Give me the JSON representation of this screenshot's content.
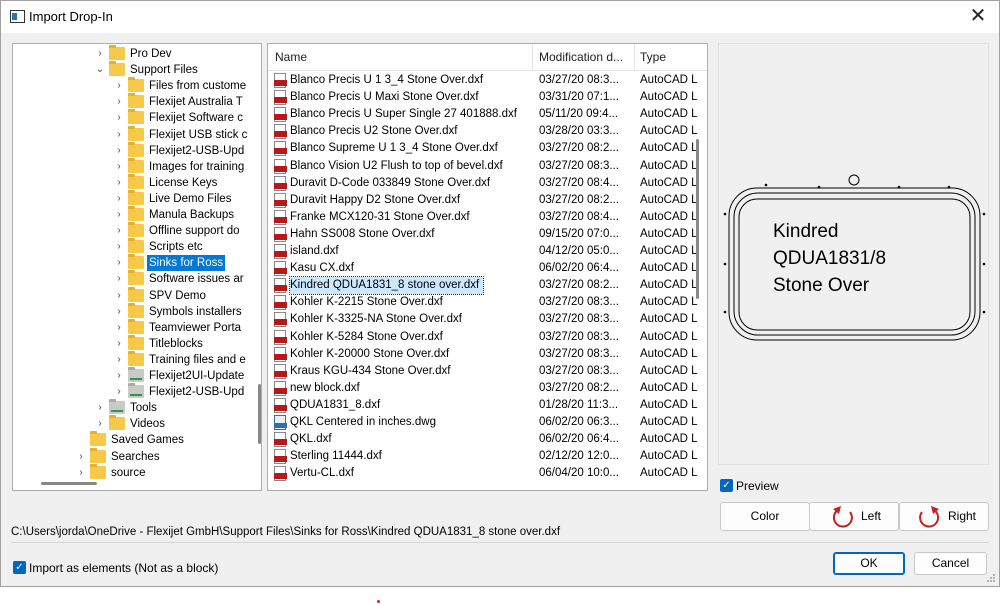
{
  "window": {
    "title": "Import Drop-In"
  },
  "tree": {
    "items": [
      {
        "label": "Pro Dev",
        "arrow": "›",
        "level": 4,
        "type": "folder"
      },
      {
        "label": "Support Files",
        "arrow": "⌄",
        "level": 4,
        "type": "folder"
      },
      {
        "label": "Files from custome",
        "arrow": "›",
        "level": 5,
        "type": "folder"
      },
      {
        "label": "Flexijet Australia T",
        "arrow": "›",
        "level": 5,
        "type": "folder"
      },
      {
        "label": "Flexijet Software c",
        "arrow": "›",
        "level": 5,
        "type": "folder"
      },
      {
        "label": "Flexijet USB stick c",
        "arrow": "›",
        "level": 5,
        "type": "folder"
      },
      {
        "label": "Flexijet2-USB-Upd",
        "arrow": "›",
        "level": 5,
        "type": "folder"
      },
      {
        "label": "Images for training",
        "arrow": "›",
        "level": 5,
        "type": "folder"
      },
      {
        "label": "License Keys",
        "arrow": "›",
        "level": 5,
        "type": "folder"
      },
      {
        "label": "Live Demo Files",
        "arrow": "›",
        "level": 5,
        "type": "folder"
      },
      {
        "label": "Manula Backups",
        "arrow": "›",
        "level": 5,
        "type": "folder"
      },
      {
        "label": "Offline support do",
        "arrow": "›",
        "level": 5,
        "type": "folder"
      },
      {
        "label": "Scripts etc",
        "arrow": "›",
        "level": 5,
        "type": "folder"
      },
      {
        "label": "Sinks for Ross",
        "arrow": "›",
        "level": 5,
        "type": "folder",
        "selected": true
      },
      {
        "label": "Software issues ar",
        "arrow": "›",
        "level": 5,
        "type": "folder"
      },
      {
        "label": "SPV Demo",
        "arrow": "›",
        "level": 5,
        "type": "folder"
      },
      {
        "label": "Symbols installers",
        "arrow": "›",
        "level": 5,
        "type": "folder"
      },
      {
        "label": "Teamviewer Porta",
        "arrow": "›",
        "level": 5,
        "type": "folder"
      },
      {
        "label": "Titleblocks",
        "arrow": "›",
        "level": 5,
        "type": "folder"
      },
      {
        "label": "Training files and e",
        "arrow": "›",
        "level": 5,
        "type": "folder"
      },
      {
        "label": "Flexijet2UI-Update",
        "arrow": "›",
        "level": 5,
        "type": "net"
      },
      {
        "label": "Flexijet2-USB-Upd",
        "arrow": "›",
        "level": 5,
        "type": "net"
      },
      {
        "label": "Tools",
        "arrow": "›",
        "level": 4,
        "type": "net"
      },
      {
        "label": "Videos",
        "arrow": "›",
        "level": 4,
        "type": "folder"
      },
      {
        "label": "Saved Games",
        "arrow": "",
        "level": 3,
        "type": "folder"
      },
      {
        "label": "Searches",
        "arrow": "›",
        "level": 3,
        "type": "folder"
      },
      {
        "label": "source",
        "arrow": "›",
        "level": 3,
        "type": "folder"
      }
    ]
  },
  "files": {
    "columns": {
      "name": "Name",
      "date": "Modification d...",
      "type": "Type"
    },
    "rows": [
      {
        "name": "Blanco Precis U 1 3_4 Stone Over.dxf",
        "date": "03/27/20 08:3...",
        "type": "AutoCAD L",
        "icon": "dxf"
      },
      {
        "name": "Blanco Precis U Maxi Stone Over.dxf",
        "date": "03/31/20 07:1...",
        "type": "AutoCAD L",
        "icon": "dxf"
      },
      {
        "name": "Blanco Precis U Super Single 27 401888.dxf",
        "date": "05/11/20 09:4...",
        "type": "AutoCAD L",
        "icon": "dxf"
      },
      {
        "name": "Blanco Precis U2 Stone Over.dxf",
        "date": "03/28/20 03:3...",
        "type": "AutoCAD L",
        "icon": "dxf"
      },
      {
        "name": "Blanco Supreme U 1 3_4 Stone Over.dxf",
        "date": "03/27/20 08:2...",
        "type": "AutoCAD L",
        "icon": "dxf"
      },
      {
        "name": "Blanco Vision U2 Flush to top of bevel.dxf",
        "date": "03/27/20 08:3...",
        "type": "AutoCAD L",
        "icon": "dxf"
      },
      {
        "name": "Duravit D-Code 033849 Stone Over.dxf",
        "date": "03/27/20 08:4...",
        "type": "AutoCAD L",
        "icon": "dxf"
      },
      {
        "name": "Duravit Happy D2 Stone Over.dxf",
        "date": "03/27/20 08:2...",
        "type": "AutoCAD L",
        "icon": "dxf"
      },
      {
        "name": "Franke MCX120-31 Stone Over.dxf",
        "date": "03/27/20 08:4...",
        "type": "AutoCAD L",
        "icon": "dxf"
      },
      {
        "name": "Hahn SS008 Stone Over.dxf",
        "date": "09/15/20 07:0...",
        "type": "AutoCAD L",
        "icon": "dxf"
      },
      {
        "name": "island.dxf",
        "date": "04/12/20 05:0...",
        "type": "AutoCAD L",
        "icon": "dxf"
      },
      {
        "name": "Kasu CX.dxf",
        "date": "06/02/20 06:4...",
        "type": "AutoCAD L",
        "icon": "dxf"
      },
      {
        "name": "Kindred QDUA1831_8 stone over.dxf",
        "date": "03/27/20 08:2...",
        "type": "AutoCAD L",
        "icon": "dxf",
        "selected": true
      },
      {
        "name": "Kohler K-2215 Stone Over.dxf",
        "date": "03/27/20 08:3...",
        "type": "AutoCAD L",
        "icon": "dxf"
      },
      {
        "name": "Kohler K-3325-NA Stone Over.dxf",
        "date": "03/27/20 08:3...",
        "type": "AutoCAD L",
        "icon": "dxf"
      },
      {
        "name": "Kohler K-5284 Stone Over.dxf",
        "date": "03/27/20 08:3...",
        "type": "AutoCAD L",
        "icon": "dxf"
      },
      {
        "name": "Kohler K-20000 Stone Over.dxf",
        "date": "03/27/20 08:3...",
        "type": "AutoCAD L",
        "icon": "dxf"
      },
      {
        "name": "Kraus KGU-434 Stone Over.dxf",
        "date": "03/27/20 08:3...",
        "type": "AutoCAD L",
        "icon": "dxf"
      },
      {
        "name": "new block.dxf",
        "date": "03/27/20 08:2...",
        "type": "AutoCAD L",
        "icon": "dxf"
      },
      {
        "name": "QDUA1831_8.dxf",
        "date": "01/28/20 11:3...",
        "type": "AutoCAD L",
        "icon": "dxf"
      },
      {
        "name": "QKL Centered in inches.dwg",
        "date": "06/02/20 06:3...",
        "type": "AutoCAD L",
        "icon": "dwg"
      },
      {
        "name": "QKL.dxf",
        "date": "06/02/20 06:4...",
        "type": "AutoCAD L",
        "icon": "dxf"
      },
      {
        "name": "Sterling 11444.dxf",
        "date": "02/12/20 12:0...",
        "type": "AutoCAD L",
        "icon": "dxf"
      },
      {
        "name": "Vertu-CL.dxf",
        "date": "06/04/20 10:0...",
        "type": "AutoCAD L",
        "icon": "dxf"
      }
    ]
  },
  "preview": {
    "lines": [
      "Kindred",
      "QDUA1831/8",
      "Stone Over"
    ],
    "checkbox_label": "Preview",
    "checked": true
  },
  "buttons": {
    "color": "Color",
    "left": "Left",
    "right": "Right",
    "ok": "OK",
    "cancel": "Cancel"
  },
  "path": "C:\\Users\\jorda\\OneDrive - Flexijet GmbH\\Support Files\\Sinks for Ross\\Kindred QDUA1831_8 stone over.dxf",
  "import_option": {
    "label": "Import as elements (Not as a block)",
    "checked": true
  },
  "colors": {
    "accent": "#0067c0",
    "selection": "#0078d7",
    "file_selection": "#cce8ff",
    "dxf_icon": "#b41a1a",
    "rotate_arrow": "#c42222"
  }
}
